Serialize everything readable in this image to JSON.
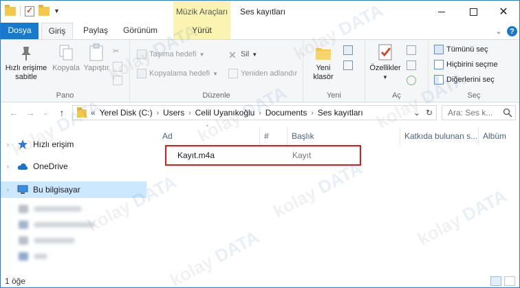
{
  "window": {
    "title": "Ses kayıtları",
    "contextual_tab_group": "Müzik Araçları",
    "controls": {
      "minimize": "–",
      "maximize": "□",
      "close": "✕"
    }
  },
  "ribbon_tabs": {
    "file": "Dosya",
    "home": "Giriş",
    "share": "Paylaş",
    "view": "Görünüm",
    "play": "Yürüt",
    "active": "Giriş"
  },
  "ribbon": {
    "clipboard": {
      "label": "Pano",
      "pin_line1": "Hızlı erişime",
      "pin_line2": "sabitle",
      "copy": "Kopyala",
      "paste": "Yapıştır"
    },
    "organize": {
      "label": "Düzenle",
      "move_to": "Taşıma hedefi",
      "copy_to": "Kopyalama hedefi",
      "delete": "Sil",
      "rename": "Yeniden adlandır"
    },
    "new": {
      "label": "Yeni",
      "new_folder_line1": "Yeni",
      "new_folder_line2": "klasör"
    },
    "open": {
      "label": "Aç",
      "properties": "Özellikler"
    },
    "select": {
      "label": "Seç",
      "select_all": "Tümünü seç",
      "select_none": "Hiçbirini seçme",
      "invert": "Diğerlerini seç"
    }
  },
  "address_bar": {
    "overflow": "«",
    "crumbs": [
      "Yerel Disk (C:)",
      "Users",
      "Celil Uyanıkoğlu",
      "Documents",
      "Ses kayıtları"
    ],
    "search_placeholder": "Ara: Ses k..."
  },
  "nav_pane": {
    "items": [
      {
        "label": "Hızlı erişim",
        "icon": "star-icon",
        "color": "#2b7bd3"
      },
      {
        "label": "OneDrive",
        "icon": "cloud-icon",
        "color": "#1a73c9"
      },
      {
        "label": "Bu bilgisayar",
        "icon": "computer-icon",
        "color": "#3a8ee6",
        "selected": true
      }
    ]
  },
  "columns": [
    "Ad",
    "#",
    "Başlık",
    "Katkıda bulunan s...",
    "Albüm"
  ],
  "files": [
    {
      "name": "Kayıt.m4a",
      "title": "Kayıt"
    }
  ],
  "status_bar": {
    "item_count": "1 öğe"
  },
  "watermark": {
    "part1": "kolay",
    "part2": "DATA"
  },
  "colors": {
    "accent": "#1979ca",
    "contextual": "#fbf4b0",
    "selection": "#cce8ff",
    "highlight_box": "#e8141c"
  }
}
